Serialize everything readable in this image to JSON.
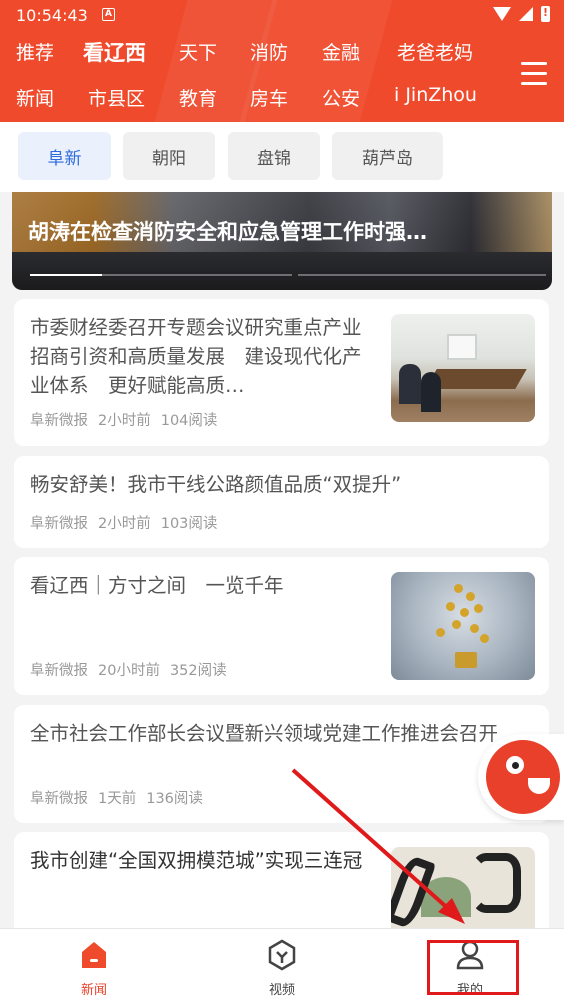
{
  "status_bar": {
    "time": "10:54:43",
    "badge": "A"
  },
  "channels": [
    {
      "label": "推荐",
      "active": false
    },
    {
      "label": "看辽西",
      "active": true
    },
    {
      "label": "天下",
      "active": false
    },
    {
      "label": "消防",
      "active": false
    },
    {
      "label": "金融",
      "active": false
    },
    {
      "label": "老爸老妈",
      "active": false
    },
    {
      "label": "新闻",
      "active": false
    },
    {
      "label": "市县区",
      "active": false
    },
    {
      "label": "教育",
      "active": false
    },
    {
      "label": "房车",
      "active": false
    },
    {
      "label": "公安",
      "active": false
    },
    {
      "label": "i JinZhou",
      "active": false
    }
  ],
  "regions": [
    {
      "label": "阜新",
      "active": true
    },
    {
      "label": "朝阳",
      "active": false
    },
    {
      "label": "盘锦",
      "active": false
    },
    {
      "label": "葫芦岛",
      "active": false
    }
  ],
  "banner": {
    "title": "胡涛在检查消防安全和应急管理工作时强…"
  },
  "articles": [
    {
      "title": "市委财经委召开专题会议研究重点产业招商引资和高质量发展　建设现代化产业体系　更好赋能高质…",
      "source": "阜新微报",
      "time": "2小时前",
      "reads": "104阅读",
      "thumbnail": "meeting-photo"
    },
    {
      "title": "畅安舒美！我市干线公路颜值品质“双提升”",
      "source": "阜新微报",
      "time": "2小时前",
      "reads": "103阅读",
      "thumbnail": ""
    },
    {
      "title": "看辽西｜方寸之间　一览千年",
      "source": "阜新微报",
      "time": "20小时前",
      "reads": "352阅读",
      "thumbnail": "gold-tree-photo"
    },
    {
      "title": "全市社会工作部长会议暨新兴领域党建工作推进会召开",
      "source": "阜新微报",
      "time": "1天前",
      "reads": "136阅读",
      "thumbnail": ""
    },
    {
      "title": "我市创建“全国双拥模范城”实现三连冠",
      "source": "",
      "time": "",
      "reads": "",
      "thumbnail": "calligraphy-photo"
    }
  ],
  "bottom_nav": [
    {
      "label": "新闻",
      "icon": "home-icon",
      "active": true
    },
    {
      "label": "视频",
      "icon": "video-icon",
      "active": false
    },
    {
      "label": "我的",
      "icon": "user-icon",
      "active": false
    }
  ],
  "colors": {
    "brand": "#f04a2c",
    "active_chip": "#2f6bdc",
    "annotation": "#e0191b"
  }
}
